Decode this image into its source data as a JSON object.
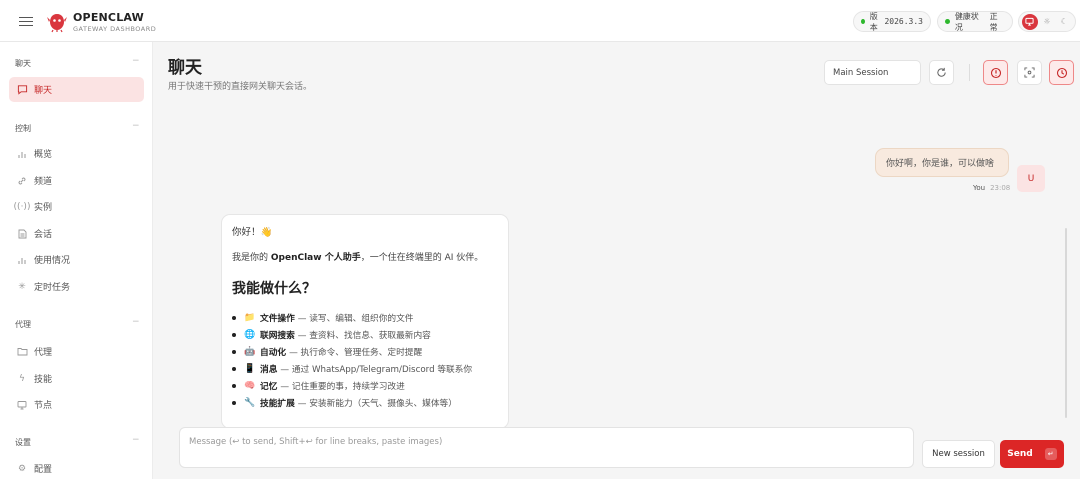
{
  "brand": {
    "title": "OPENCLAW",
    "subtitle": "GATEWAY DASHBOARD"
  },
  "status": {
    "version_label": "版本",
    "version_value": "2026.3.3",
    "health_label": "健康状况",
    "health_value": "正常",
    "status_color": "#2eb82e"
  },
  "theme": {
    "icons": [
      "monitor-icon",
      "sun-icon",
      "moon-icon"
    ],
    "accent": "#dc2626"
  },
  "sidebar": {
    "sections": [
      {
        "title": "聊天",
        "items": [
          {
            "label": "聊天",
            "icon": "chat-icon",
            "active": true
          }
        ]
      },
      {
        "title": "控制",
        "items": [
          {
            "label": "概览",
            "icon": "bar-chart-icon"
          },
          {
            "label": "频道",
            "icon": "link-icon"
          },
          {
            "label": "实例",
            "icon": "radio-icon"
          },
          {
            "label": "会话",
            "icon": "document-icon"
          },
          {
            "label": "使用情况",
            "icon": "bar-chart-icon"
          },
          {
            "label": "定时任务",
            "icon": "loader-icon"
          }
        ]
      },
      {
        "title": "代理",
        "items": [
          {
            "label": "代理",
            "icon": "folder-icon"
          },
          {
            "label": "技能",
            "icon": "zap-icon"
          },
          {
            "label": "节点",
            "icon": "monitor-icon"
          }
        ]
      },
      {
        "title": "设置",
        "items": [
          {
            "label": "配置",
            "icon": "gear-icon"
          }
        ]
      }
    ]
  },
  "page": {
    "title": "聊天",
    "subtitle": "用于快速干预的直接网关聊天会话。"
  },
  "toolbar": {
    "session_value": "Main Session"
  },
  "chat": {
    "user_message": "你好啊，你是谁，可以做啥",
    "user_name": "You",
    "user_time": "23:08",
    "user_avatar": "U",
    "assistant": {
      "greeting": "你好！👋",
      "intro_prefix": "我是你的 ",
      "intro_bold": "OpenClaw 个人助手",
      "intro_suffix": "，一个住在终端里的 AI 伙伴。",
      "heading": "我能做什么？",
      "capabilities": [
        {
          "emoji": "📁",
          "title": "文件操作",
          "desc": "— 读写、编辑、组织你的文件"
        },
        {
          "emoji": "🌐",
          "title": "联网搜索",
          "desc": "— 查资料、找信息、获取最新内容"
        },
        {
          "emoji": "🤖",
          "title": "自动化",
          "desc": "— 执行命令、管理任务、定时提醒"
        },
        {
          "emoji": "📱",
          "title": "消息",
          "desc": "— 通过 WhatsApp/Telegram/Discord 等联系你"
        },
        {
          "emoji": "🧠",
          "title": "记忆",
          "desc": "— 记住重要的事，持续学习改进"
        },
        {
          "emoji": "🔧",
          "title": "技能扩展",
          "desc": "— 安装新能力（天气、摄像头、媒体等）"
        }
      ]
    }
  },
  "composer": {
    "placeholder": "Message (↩ to send, Shift+↩ for line breaks, paste images)",
    "new_session_label": "New session",
    "send_label": "Send",
    "send_shortcut": "↵"
  }
}
